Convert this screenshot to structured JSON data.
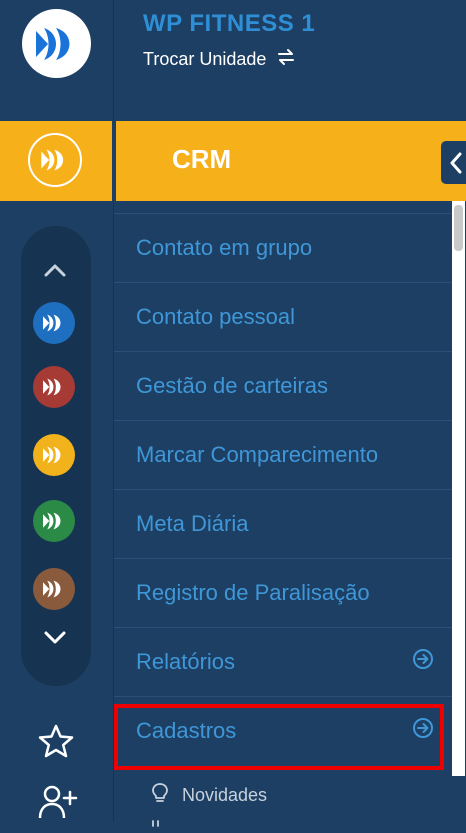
{
  "header": {
    "title": "WP FITNESS 1",
    "subtitle": "Trocar Unidade"
  },
  "active_module": {
    "label": "CRM",
    "accent_color": "#f5b01a"
  },
  "module_switcher": {
    "modules": [
      {
        "icon": "pacto-logo-icon",
        "color": "#1f6fc0"
      },
      {
        "icon": "pacto-logo-icon",
        "color": "#a63a34"
      },
      {
        "icon": "pacto-logo-icon",
        "color": "#f2b21b"
      },
      {
        "icon": "pacto-logo-icon",
        "color": "#2a8a46"
      },
      {
        "icon": "pacto-logo-icon",
        "color": "#8a5a3c"
      }
    ]
  },
  "menu": {
    "items": [
      {
        "label": "Contato em grupo",
        "has_arrow": false
      },
      {
        "label": "Contato pessoal",
        "has_arrow": false
      },
      {
        "label": "Gestão de carteiras",
        "has_arrow": false
      },
      {
        "label": "Marcar Comparecimento",
        "has_arrow": false
      },
      {
        "label": "Meta Diária",
        "has_arrow": false
      },
      {
        "label": "Registro de Paralisação",
        "has_arrow": false
      },
      {
        "label": "Relatórios",
        "has_arrow": true
      },
      {
        "label": "Cadastros",
        "has_arrow": true
      }
    ]
  },
  "footer": {
    "novidades_label": "Novidades"
  }
}
